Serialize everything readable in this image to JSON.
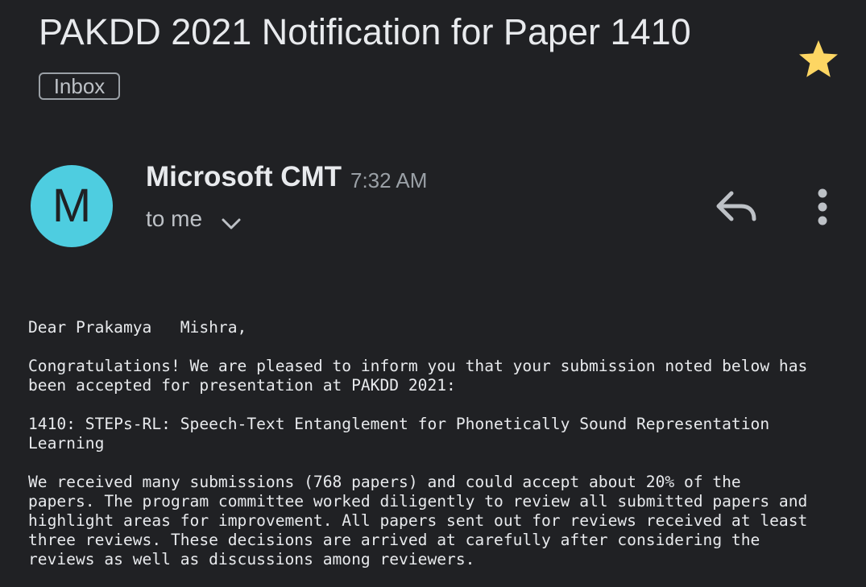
{
  "email": {
    "subject": "PAKDD 2021 Notification for Paper 1410",
    "label": "Inbox",
    "starred": true,
    "sender": {
      "name": "Microsoft CMT",
      "avatar_letter": "M",
      "avatar_color": "#4ecde0"
    },
    "time": "7:32 AM",
    "recipient": "to me",
    "icons": {
      "star": "star-icon",
      "reply": "reply-icon",
      "more": "more-vert-icon",
      "expand": "chevron-down-icon"
    },
    "body": {
      "greeting": [
        "Dear Prakamya   Mishra,"
      ],
      "paragraph_1": [
        "Congratulations! We are pleased to inform you that your submission noted below has",
        "been accepted for presentation at PAKDD 2021:"
      ],
      "paragraph_2": [
        "1410: STEPs-RL: Speech-Text Entanglement for Phonetically Sound Representation",
        "Learning"
      ],
      "paragraph_3": [
        "We received many submissions (768 papers) and could accept about 20% of the",
        "papers. The program committee worked diligently to review all submitted papers and",
        "highlight areas for improvement. All papers sent out for reviews received at least",
        "three reviews. These decisions are arrived at carefully after considering the",
        "reviews as well as discussions among reviewers."
      ]
    }
  },
  "colors": {
    "background": "#202124",
    "star": "#fdd663",
    "text": "#e8eaed",
    "muted": "#9aa0a6"
  }
}
